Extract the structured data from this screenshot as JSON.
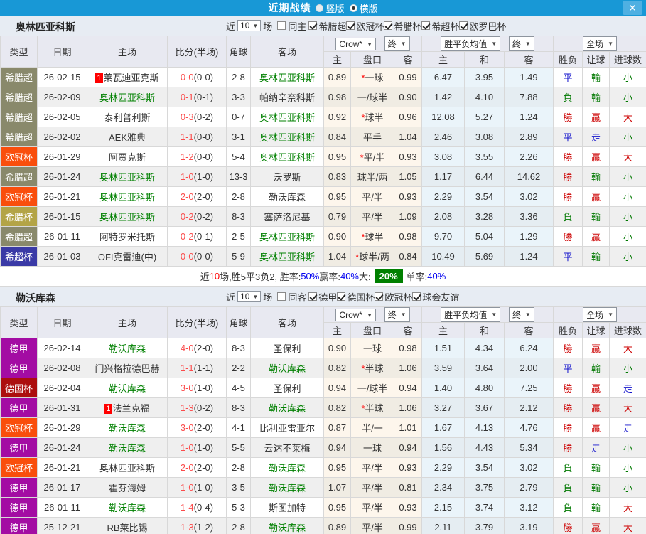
{
  "titlebar": {
    "title": "近期战绩",
    "radio_vertical": "竖版",
    "radio_horizontal": "横版",
    "layout_selected": "横版",
    "close": "✕"
  },
  "filter_labels": {
    "near": "近",
    "matches": "场"
  },
  "columns": {
    "type": "类型",
    "date": "日期",
    "home": "主场",
    "score": "比分(半场)",
    "corners": "角球",
    "away": "客场",
    "host": "主",
    "handicap": "盘口",
    "guest": "客",
    "avg_home": "主",
    "avg_draw": "和",
    "avg_away": "客",
    "outcome": "胜负",
    "handicap_result": "让球",
    "goals": "进球数",
    "company": "Crow*",
    "final": "终",
    "wdl_avg": "胜平负均值",
    "full": "全场"
  },
  "colors": {
    "topbar": "#1898d6",
    "close_button": "#4fb0e2",
    "section_band": "#e7ecf3",
    "team_highlight": "#008000",
    "score": "#fb4b4b",
    "badge_red": "#ff0000",
    "summary_blue": "#0000f0",
    "summary_red": "#ff0000",
    "summary_box_bg": "#008000",
    "win": "#cc0000",
    "draw": "#1515cc",
    "lose": "#007800",
    "leagues": {
      "希腊超": "#89896b",
      "欧冠杯": "#f94e0c",
      "希腊杯": "#b3a446",
      "希超杯": "#3a3aa6",
      "德甲": "#a30ca3",
      "德国杯": "#ac0e0e"
    }
  },
  "result_class": {
    "勝": "win",
    "贏": "win",
    "大": "win",
    "平": "draw",
    "走": "draw",
    "負": "lose",
    "輸": "lose",
    "小": "lose"
  },
  "sections": [
    {
      "team": "奥林匹亚科斯",
      "filter": {
        "count": "10",
        "same_label": "同主",
        "same_checked": false,
        "leagues": [
          "希腊超",
          "欧冠杯",
          "希腊杯",
          "希超杯",
          "欧罗巴杯"
        ]
      },
      "rows": [
        {
          "league": "希腊超",
          "date": "26-02-15",
          "home": "莱瓦迪亚克斯",
          "home_badge": "1",
          "home_green": false,
          "score": "0-0",
          "half": "(0-0)",
          "corners": "2-8",
          "away": "奥林匹亚科斯",
          "away_green": true,
          "host_odds": "0.89",
          "handicap": "*一球",
          "guest_odds": "0.99",
          "avg_home": "6.47",
          "avg_draw": "3.95",
          "avg_away": "1.49",
          "outcome": "平",
          "handicap_result": "輸",
          "goals_result": "小"
        },
        {
          "league": "希腊超",
          "date": "26-02-09",
          "home": "奥林匹亚科斯",
          "home_green": true,
          "score": "0-1",
          "half": "(0-1)",
          "corners": "3-3",
          "away": "帕纳辛奈科斯",
          "away_green": false,
          "host_odds": "0.98",
          "handicap": "一/球半",
          "guest_odds": "0.90",
          "avg_home": "1.42",
          "avg_draw": "4.10",
          "avg_away": "7.88",
          "outcome": "負",
          "handicap_result": "輸",
          "goals_result": "小"
        },
        {
          "league": "希腊超",
          "date": "26-02-05",
          "home": "泰利普利斯",
          "home_green": false,
          "score": "0-3",
          "half": "(0-2)",
          "corners": "0-7",
          "away": "奥林匹亚科斯",
          "away_green": true,
          "host_odds": "0.92",
          "handicap": "*球半",
          "guest_odds": "0.96",
          "avg_home": "12.08",
          "avg_draw": "5.27",
          "avg_away": "1.24",
          "outcome": "勝",
          "handicap_result": "贏",
          "goals_result": "大"
        },
        {
          "league": "希腊超",
          "date": "26-02-02",
          "home": "AEK雅典",
          "home_green": false,
          "score": "1-1",
          "half": "(0-0)",
          "corners": "3-1",
          "away": "奥林匹亚科斯",
          "away_green": true,
          "host_odds": "0.84",
          "handicap": "平手",
          "guest_odds": "1.04",
          "avg_home": "2.46",
          "avg_draw": "3.08",
          "avg_away": "2.89",
          "outcome": "平",
          "handicap_result": "走",
          "goals_result": "小"
        },
        {
          "league": "欧冠杯",
          "date": "26-01-29",
          "home": "阿贾克斯",
          "home_green": false,
          "score": "1-2",
          "half": "(0-0)",
          "corners": "5-4",
          "away": "奥林匹亚科斯",
          "away_green": true,
          "host_odds": "0.95",
          "handicap": "*平/半",
          "guest_odds": "0.93",
          "avg_home": "3.08",
          "avg_draw": "3.55",
          "avg_away": "2.26",
          "outcome": "勝",
          "handicap_result": "贏",
          "goals_result": "大"
        },
        {
          "league": "希腊超",
          "date": "26-01-24",
          "home": "奥林匹亚科斯",
          "home_green": true,
          "score": "1-0",
          "half": "(1-0)",
          "corners": "13-3",
          "away": "沃罗斯",
          "away_green": false,
          "host_odds": "0.83",
          "handicap": "球半/两",
          "guest_odds": "1.05",
          "avg_home": "1.17",
          "avg_draw": "6.44",
          "avg_away": "14.62",
          "outcome": "勝",
          "handicap_result": "輸",
          "goals_result": "小"
        },
        {
          "league": "欧冠杯",
          "date": "26-01-21",
          "home": "奥林匹亚科斯",
          "home_green": true,
          "score": "2-0",
          "half": "(2-0)",
          "corners": "2-8",
          "away": "勒沃库森",
          "away_green": false,
          "host_odds": "0.95",
          "handicap": "平/半",
          "guest_odds": "0.93",
          "avg_home": "2.29",
          "avg_draw": "3.54",
          "avg_away": "3.02",
          "outcome": "勝",
          "handicap_result": "贏",
          "goals_result": "小"
        },
        {
          "league": "希腊杯",
          "date": "26-01-15",
          "home": "奥林匹亚科斯",
          "home_green": true,
          "score": "0-2",
          "half": "(0-2)",
          "corners": "8-3",
          "away": "塞萨洛尼基",
          "away_green": false,
          "host_odds": "0.79",
          "handicap": "平/半",
          "guest_odds": "1.09",
          "avg_home": "2.08",
          "avg_draw": "3.28",
          "avg_away": "3.36",
          "outcome": "負",
          "handicap_result": "輸",
          "goals_result": "小"
        },
        {
          "league": "希腊超",
          "date": "26-01-11",
          "home": "阿特罗米托斯",
          "home_green": false,
          "score": "0-2",
          "half": "(0-1)",
          "corners": "2-5",
          "away": "奥林匹亚科斯",
          "away_green": true,
          "host_odds": "0.90",
          "handicap": "*球半",
          "guest_odds": "0.98",
          "avg_home": "9.70",
          "avg_draw": "5.04",
          "avg_away": "1.29",
          "outcome": "勝",
          "handicap_result": "贏",
          "goals_result": "小"
        },
        {
          "league": "希超杯",
          "date": "26-01-03",
          "home": "OFI克雷迪(中)",
          "home_green": false,
          "score": "0-0",
          "half": "(0-0)",
          "corners": "5-9",
          "away": "奥林匹亚科斯",
          "away_green": true,
          "host_odds": "1.04",
          "handicap": "*球半/两",
          "guest_odds": "0.84",
          "avg_home": "10.49",
          "avg_draw": "5.69",
          "avg_away": "1.24",
          "outcome": "平",
          "handicap_result": "輸",
          "goals_result": "小"
        }
      ],
      "summary": [
        {
          "t": "近"
        },
        {
          "t": "10",
          "s": "red"
        },
        {
          "t": "场,胜5平3负2, 胜率:"
        },
        {
          "t": "50%",
          "s": "blue"
        },
        {
          "t": " 赢率:"
        },
        {
          "t": "40%",
          "s": "blue"
        },
        {
          "t": " 大:"
        },
        {
          "t": "20%",
          "s": "box"
        },
        {
          "t": "单率:"
        },
        {
          "t": "40%",
          "s": "blue"
        }
      ]
    },
    {
      "team": "勒沃库森",
      "filter": {
        "count": "10",
        "same_label": "同客",
        "same_checked": false,
        "leagues": [
          "德甲",
          "德国杯",
          "欧冠杯",
          "球会友谊"
        ]
      },
      "rows": [
        {
          "league": "德甲",
          "date": "26-02-14",
          "home": "勒沃库森",
          "home_green": true,
          "score": "4-0",
          "half": "(2-0)",
          "corners": "8-3",
          "away": "圣保利",
          "away_green": false,
          "host_odds": "0.90",
          "handicap": "一球",
          "guest_odds": "0.98",
          "avg_home": "1.51",
          "avg_draw": "4.34",
          "avg_away": "6.24",
          "outcome": "勝",
          "handicap_result": "贏",
          "goals_result": "大"
        },
        {
          "league": "德甲",
          "date": "26-02-08",
          "home": "门兴格拉德巴赫",
          "home_green": false,
          "score": "1-1",
          "half": "(1-1)",
          "corners": "2-2",
          "away": "勒沃库森",
          "away_green": true,
          "host_odds": "0.82",
          "handicap": "*半球",
          "guest_odds": "1.06",
          "avg_home": "3.59",
          "avg_draw": "3.64",
          "avg_away": "2.00",
          "outcome": "平",
          "handicap_result": "輸",
          "goals_result": "小"
        },
        {
          "league": "德国杯",
          "date": "26-02-04",
          "home": "勒沃库森",
          "home_green": true,
          "score": "3-0",
          "half": "(1-0)",
          "corners": "4-5",
          "away": "圣保利",
          "away_green": false,
          "host_odds": "0.94",
          "handicap": "一/球半",
          "guest_odds": "0.94",
          "avg_home": "1.40",
          "avg_draw": "4.80",
          "avg_away": "7.25",
          "outcome": "勝",
          "handicap_result": "贏",
          "goals_result": "走"
        },
        {
          "league": "德甲",
          "date": "26-01-31",
          "home": "法兰克福",
          "home_badge": "1",
          "home_green": false,
          "score": "1-3",
          "half": "(0-2)",
          "corners": "8-3",
          "away": "勒沃库森",
          "away_green": true,
          "host_odds": "0.82",
          "handicap": "*半球",
          "guest_odds": "1.06",
          "avg_home": "3.27",
          "avg_draw": "3.67",
          "avg_away": "2.12",
          "outcome": "勝",
          "handicap_result": "贏",
          "goals_result": "大"
        },
        {
          "league": "欧冠杯",
          "date": "26-01-29",
          "home": "勒沃库森",
          "home_green": true,
          "score": "3-0",
          "half": "(2-0)",
          "corners": "4-1",
          "away": "比利亚雷亚尔",
          "away_green": false,
          "host_odds": "0.87",
          "handicap": "半/一",
          "guest_odds": "1.01",
          "avg_home": "1.67",
          "avg_draw": "4.13",
          "avg_away": "4.76",
          "outcome": "勝",
          "handicap_result": "贏",
          "goals_result": "走"
        },
        {
          "league": "德甲",
          "date": "26-01-24",
          "home": "勒沃库森",
          "home_green": true,
          "score": "1-0",
          "half": "(1-0)",
          "corners": "5-5",
          "away": "云达不莱梅",
          "away_green": false,
          "host_odds": "0.94",
          "handicap": "一球",
          "guest_odds": "0.94",
          "avg_home": "1.56",
          "avg_draw": "4.43",
          "avg_away": "5.34",
          "outcome": "勝",
          "handicap_result": "走",
          "goals_result": "小"
        },
        {
          "league": "欧冠杯",
          "date": "26-01-21",
          "home": "奥林匹亚科斯",
          "home_green": false,
          "score": "2-0",
          "half": "(2-0)",
          "corners": "2-8",
          "away": "勒沃库森",
          "away_green": true,
          "host_odds": "0.95",
          "handicap": "平/半",
          "guest_odds": "0.93",
          "avg_home": "2.29",
          "avg_draw": "3.54",
          "avg_away": "3.02",
          "outcome": "負",
          "handicap_result": "輸",
          "goals_result": "小"
        },
        {
          "league": "德甲",
          "date": "26-01-17",
          "home": "霍芬海姆",
          "home_green": false,
          "score": "1-0",
          "half": "(1-0)",
          "corners": "3-5",
          "away": "勒沃库森",
          "away_green": true,
          "host_odds": "1.07",
          "handicap": "平/半",
          "guest_odds": "0.81",
          "avg_home": "2.34",
          "avg_draw": "3.75",
          "avg_away": "2.79",
          "outcome": "負",
          "handicap_result": "輸",
          "goals_result": "小"
        },
        {
          "league": "德甲",
          "date": "26-01-11",
          "home": "勒沃库森",
          "home_green": true,
          "score": "1-4",
          "half": "(0-4)",
          "corners": "5-3",
          "away": "斯图加特",
          "away_green": false,
          "host_odds": "0.95",
          "handicap": "平/半",
          "guest_odds": "0.93",
          "avg_home": "2.15",
          "avg_draw": "3.74",
          "avg_away": "3.12",
          "outcome": "負",
          "handicap_result": "輸",
          "goals_result": "大"
        },
        {
          "league": "德甲",
          "date": "25-12-21",
          "home": "RB莱比锡",
          "home_green": false,
          "score": "1-3",
          "half": "(1-2)",
          "corners": "2-8",
          "away": "勒沃库森",
          "away_green": true,
          "host_odds": "0.89",
          "handicap": "平/半",
          "guest_odds": "0.99",
          "avg_home": "2.11",
          "avg_draw": "3.79",
          "avg_away": "3.19",
          "outcome": "勝",
          "handicap_result": "贏",
          "goals_result": "大"
        }
      ]
    }
  ]
}
